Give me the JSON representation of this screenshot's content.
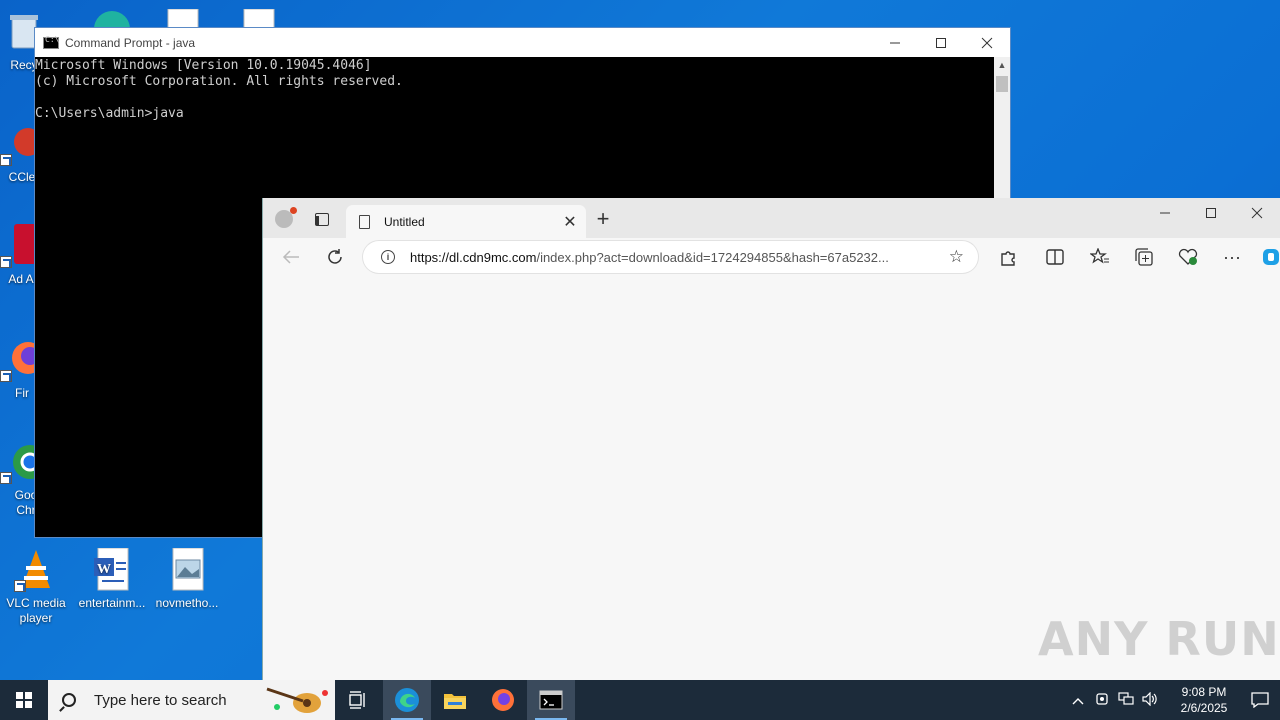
{
  "desktop": {
    "icons": [
      {
        "label": "Recy"
      },
      {
        "label": "CCle"
      },
      {
        "label": "Ad Acr"
      },
      {
        "label": "Fir"
      },
      {
        "label": "Goo Chr"
      },
      {
        "label": "VLC media player"
      },
      {
        "label": "entertainm..."
      },
      {
        "label": "novmetho..."
      }
    ]
  },
  "cmd": {
    "title": "Command Prompt - java",
    "output": "Microsoft Windows [Version 10.0.19045.4046]\n(c) Microsoft Corporation. All rights reserved.\n\nC:\\Users\\admin>java"
  },
  "browser": {
    "tab_title": "Untitled",
    "url_host": "https://dl.cdn9mc.com",
    "url_rest": "/index.php?act=download&id=1724294855&hash=67a5232..."
  },
  "watermark": "ANY RUN",
  "taskbar": {
    "search_placeholder": "Type here to search",
    "time": "9:08 PM",
    "date": "2/6/2025"
  },
  "colors": {
    "desktop_bg": "#0a63c9",
    "taskbar_bg": "#1c2b3a",
    "cmd_bg": "#000000",
    "browser_bg": "#f7f7f7"
  }
}
